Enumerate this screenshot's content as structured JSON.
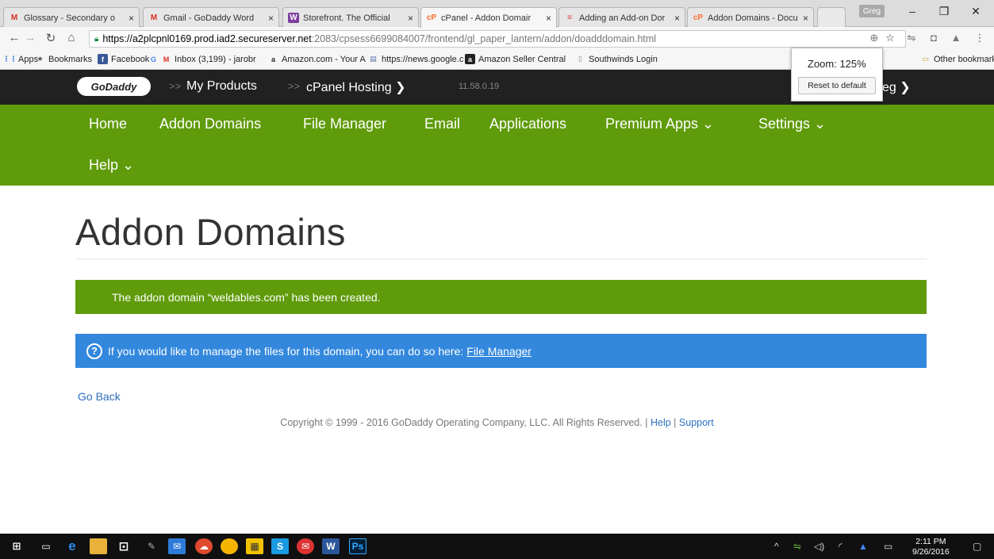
{
  "browser": {
    "tabs": [
      {
        "title": "Glossary - Secondary o",
        "icon_text": "M",
        "icon_color": "#d93025"
      },
      {
        "title": "Gmail - GoDaddy Word",
        "icon_text": "M",
        "icon_color": "#d93025"
      },
      {
        "title": "Storefront. The Official",
        "icon_text": "W",
        "icon_color": "#7b3fa0"
      },
      {
        "title": "cPanel - Addon Domair",
        "icon_text": "cP",
        "icon_color": "#ff6c2c"
      },
      {
        "title": "Adding an Add-on Dor",
        "icon_text": "≡",
        "icon_color": "#e53935"
      },
      {
        "title": "Addon Domains - Docu",
        "icon_text": "cP",
        "icon_color": "#ff6c2c"
      }
    ],
    "tab_close": "×",
    "profile": "Greg",
    "url_host": "https://a2plcpnl0169.prod.iad2.secureserver.net",
    "url_path": ":2083/cpsess6699084007/frontend/gl_paper_lantern/addon/doadddomain.html",
    "bookmarks": [
      {
        "label": "Apps",
        "icon_text": "⋮⋮",
        "icon_color": "#1a73e8"
      },
      {
        "label": "Bookmarks",
        "icon_text": "★",
        "icon_color": "#555555"
      },
      {
        "label": "Facebook",
        "icon_text": "f",
        "icon_color": "#3b5998"
      },
      {
        "label": "",
        "icon_text": "G",
        "icon_color": "#4285f4"
      },
      {
        "label": "Inbox (3,199) - jarobr",
        "icon_text": "M",
        "icon_color": "#d93025"
      },
      {
        "label": "Amazon.com - Your A",
        "icon_text": "a",
        "icon_color": "#222222"
      },
      {
        "label": "https://news.google.c",
        "icon_text": "▤",
        "icon_color": "#5a6ea8"
      },
      {
        "label": "Amazon Seller Central",
        "icon_text": "a",
        "icon_color": "#222222"
      },
      {
        "label": "Southwinds Login",
        "icon_text": "▯",
        "icon_color": "#888888"
      }
    ],
    "other_bookmarks": "Other bookmarks",
    "zoom_label": "Zoom: 125%",
    "zoom_reset": "Reset to default"
  },
  "godaddy_bar": {
    "logo": "GoDaddy",
    "sep": ">>",
    "my_products": "My Products",
    "cpanel_hosting": "cPanel Hosting ❯",
    "version": "11.58.0.19",
    "user": "eg ❯"
  },
  "nav": {
    "home": "Home",
    "addon_domains": "Addon Domains",
    "file_manager": "File Manager",
    "email": "Email",
    "applications": "Applications",
    "premium_apps": "Premium Apps ⌄",
    "settings": "Settings ⌄",
    "help": "Help ⌄"
  },
  "content": {
    "title": "Addon Domains",
    "success_message": "The addon domain “weldables.com” has been created.",
    "info_message": "If you would like to manage the files for this domain, you can do so here:",
    "info_link": "File Manager",
    "go_back": "Go Back",
    "copyright": "Copyright © 1999 - 2016 GoDaddy Operating Company, LLC. All Rights Reserved.",
    "footer_sep": "|",
    "footer_help": "Help",
    "footer_support": "Support"
  },
  "taskbar": {
    "time": "2:11 PM",
    "date": "9/26/2016"
  },
  "colors": {
    "green": "#5f9b0a",
    "blue": "#3388dd",
    "dark": "#212121"
  }
}
